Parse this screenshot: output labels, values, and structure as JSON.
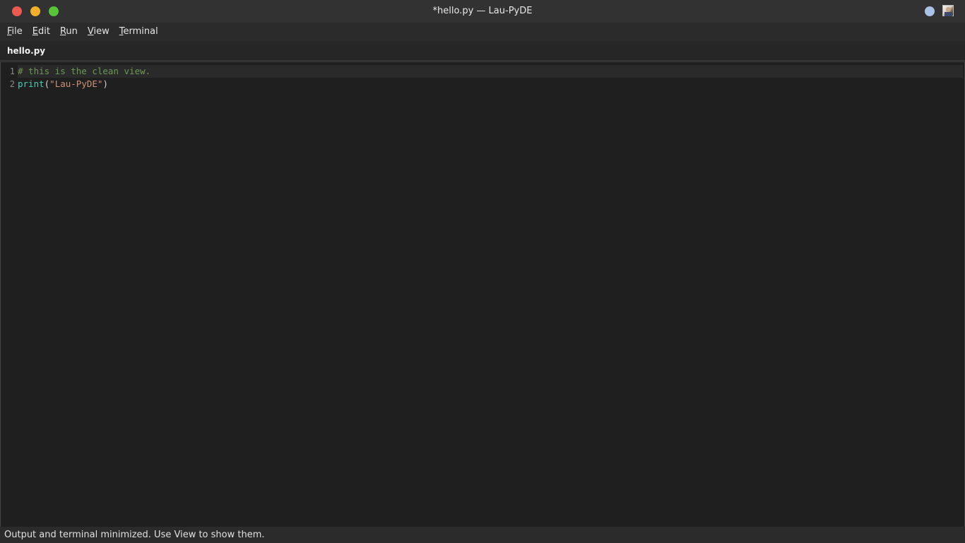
{
  "window": {
    "title": "*hello.py — Lau-PyDE"
  },
  "menu": {
    "items": [
      {
        "mnemonic": "F",
        "rest": "ile"
      },
      {
        "mnemonic": "E",
        "rest": "dit"
      },
      {
        "mnemonic": "R",
        "rest": "un"
      },
      {
        "mnemonic": "V",
        "rest": "iew"
      },
      {
        "mnemonic": "T",
        "rest": "erminal"
      }
    ]
  },
  "tabs": [
    {
      "label": "hello.py",
      "active": true
    }
  ],
  "editor": {
    "lines": [
      {
        "number": "1",
        "comment": "# this is the clean view."
      },
      {
        "number": "2",
        "builtin": "print",
        "open_paren": "(",
        "string": "\"Lau-PyDE\"",
        "close_paren": ")"
      }
    ],
    "current_line": 1
  },
  "status": {
    "message": "Output and terminal minimized. Use View to show them."
  },
  "colors": {
    "close": "#ee5a52",
    "minimize": "#f1b02a",
    "maximize": "#55c639",
    "comment": "#6a9955",
    "builtin": "#4ec9b0",
    "string": "#ce9178",
    "tray_dot": "#a9c3e6"
  },
  "icons": {
    "tray_status": "status-dot-icon",
    "tray_user": "user-avatar-icon"
  }
}
